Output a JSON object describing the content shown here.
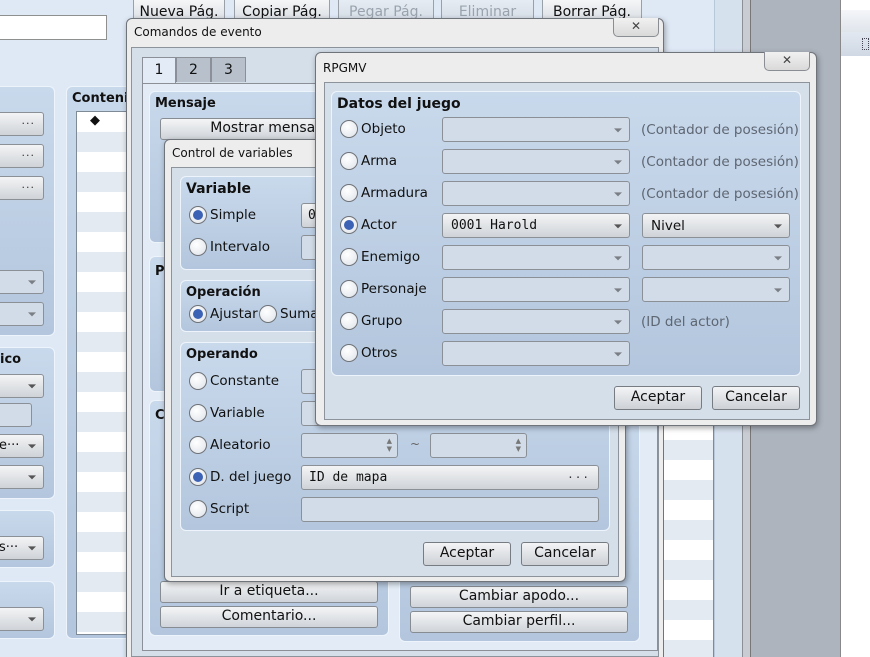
{
  "background_editor": {
    "page_buttons": [
      {
        "label": "Nueva Pág.",
        "enabled": true
      },
      {
        "label": "Copiar Pág.",
        "enabled": true
      },
      {
        "label": "Pegar Pág.",
        "enabled": false
      },
      {
        "label": "Eliminar Pág.",
        "enabled": false
      },
      {
        "label": "Borrar Pág.",
        "enabled": true
      }
    ],
    "contents_title": "Conteni",
    "contents_first_marker": "◆",
    "graphic_group_title": "ico",
    "truncated_select_1": "e···",
    "truncated_select_2": "s···",
    "truncated_input": "."
  },
  "event_commands": {
    "title": "Comandos de evento",
    "close_label": "✕",
    "tabs": [
      "1",
      "2",
      "3"
    ],
    "active_tab": "1",
    "group_message": "Mensaje",
    "button_show_message": "Mostrar mensaje",
    "group_p_initial": "P",
    "group_c_initial": "C",
    "left_buttons": [
      "Ir a etiqueta...",
      "Comentario..."
    ],
    "right_buttons": [
      "Cambiar apodo...",
      "Cambiar perfil..."
    ]
  },
  "variable_control": {
    "title": "Control de variables",
    "variable_group": "Variable",
    "variable_options": [
      {
        "label": "Simple",
        "selected": true,
        "value": "0"
      },
      {
        "label": "Intervalo",
        "selected": false,
        "value": ""
      }
    ],
    "operation_group": "Operación",
    "operation_options": [
      {
        "label": "Ajustar",
        "selected": true
      },
      {
        "label": "Sumar",
        "selected": false
      }
    ],
    "operand_group": "Operando",
    "operand_options": [
      {
        "label": "Constante",
        "selected": false
      },
      {
        "label": "Variable",
        "selected": false
      },
      {
        "label": "Aleatorio",
        "selected": false
      },
      {
        "label": "D. del juego",
        "selected": true
      },
      {
        "label": "Script",
        "selected": false
      }
    ],
    "random_separator": "~",
    "game_data_value": "ID de mapa",
    "script_value": "",
    "ok_label": "Aceptar",
    "cancel_label": "Cancelar"
  },
  "game_data_dialog": {
    "title": "RPGMV",
    "close_label": "✕",
    "group_title": "Datos del juego",
    "rows": [
      {
        "label": "Objeto",
        "selected": false,
        "select1": "",
        "select1_enabled": false,
        "hint": "(Contador de posesión)"
      },
      {
        "label": "Arma",
        "selected": false,
        "select1": "",
        "select1_enabled": false,
        "hint": "(Contador de posesión)"
      },
      {
        "label": "Armadura",
        "selected": false,
        "select1": "",
        "select1_enabled": false,
        "hint": "(Contador de posesión)"
      },
      {
        "label": "Actor",
        "selected": true,
        "select1": "0001 Harold",
        "select1_enabled": true,
        "select2": "Nivel",
        "select2_enabled": true
      },
      {
        "label": "Enemigo",
        "selected": false,
        "select1": "",
        "select1_enabled": false,
        "select2": "",
        "select2_enabled": false
      },
      {
        "label": "Personaje",
        "selected": false,
        "select1": "",
        "select1_enabled": false,
        "select2": "",
        "select2_enabled": false
      },
      {
        "label": "Grupo",
        "selected": false,
        "select1": "",
        "select1_enabled": false,
        "hint": "(ID del actor)"
      },
      {
        "label": "Otros",
        "selected": false,
        "select1": "",
        "select1_enabled": false
      }
    ],
    "ok_label": "Aceptar",
    "cancel_label": "Cancelar"
  }
}
